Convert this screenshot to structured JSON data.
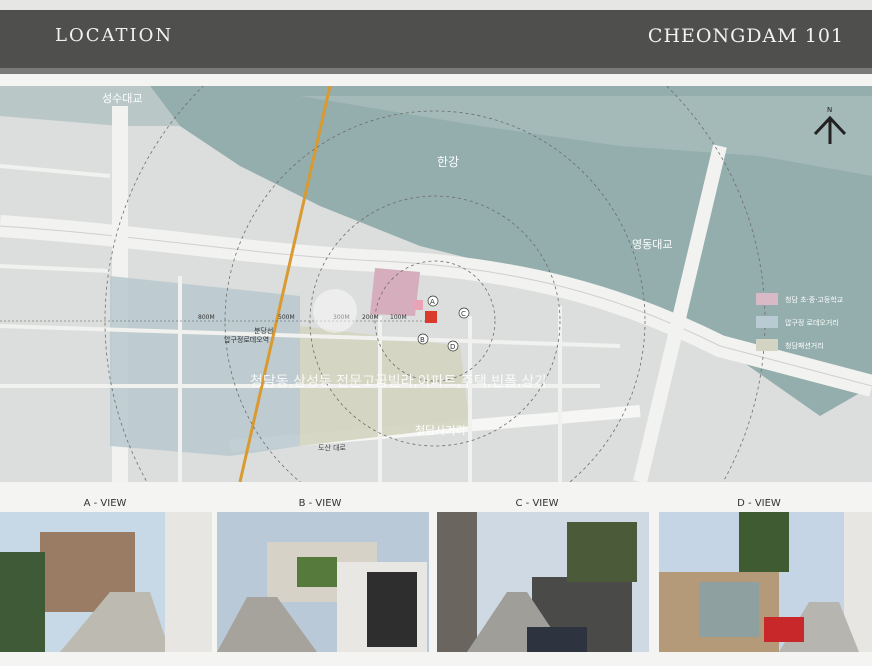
{
  "header": {
    "left": "LOCATION",
    "right": "CHEONGDAM 101"
  },
  "map": {
    "label_seongsu": "성수대교",
    "label_hangang": "한강",
    "label_yeongdong": "영동대교",
    "label_cheongdam_4": "청담사거리",
    "label_dosan": "도산 대로",
    "label_station_line": "분당선",
    "label_station_name": "압구정로데오역",
    "dist_800": "800M",
    "dist_500": "500M",
    "dist_300": "300M",
    "dist_200": "200M",
    "dist_100": "100M",
    "area_text": "청담동,삼성동 전문고급빌라,아파트,주택,빈폴,상가",
    "marker_a": "A",
    "marker_b": "B",
    "marker_c": "C",
    "marker_d": "D",
    "north": "N",
    "legend": [
      {
        "label": "청담 초·중·고등학교",
        "color": "#d9b9c6"
      },
      {
        "label": "압구정 로데오거리",
        "color": "#b9cbd2"
      },
      {
        "label": "청담패션거리",
        "color": "#d3d4c1"
      }
    ]
  },
  "views": [
    {
      "label": "A - VIEW"
    },
    {
      "label": "B - VIEW"
    },
    {
      "label": "C - VIEW"
    },
    {
      "label": "D - VIEW"
    }
  ]
}
